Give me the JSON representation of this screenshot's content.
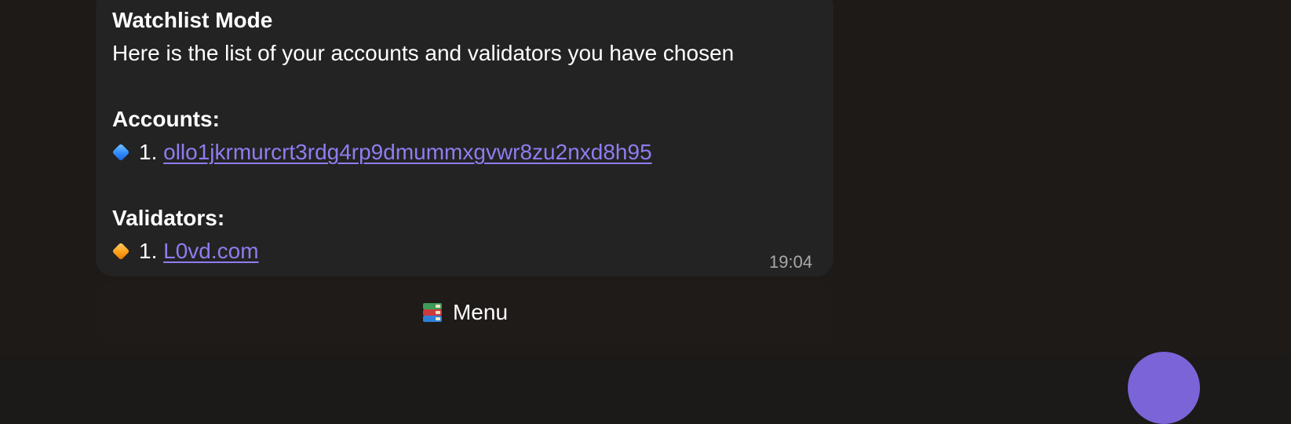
{
  "message": {
    "title": "Watchlist Mode",
    "intro": "Here is the list of your accounts and validators you have chosen",
    "accounts_heading": "Accounts:",
    "accounts": [
      {
        "index": "1.",
        "address": "ollo1jkrmurcrt3rdg4rp9dmummxgvwr8zu2nxd8h95",
        "icon": "blue-diamond-icon"
      }
    ],
    "validators_heading": "Validators:",
    "validators": [
      {
        "index": "1.",
        "name": "L0vd.com",
        "icon": "orange-diamond-icon"
      }
    ],
    "timestamp": "19:04"
  },
  "keyboard": {
    "button_label": "Menu",
    "button_icon": "books-icon"
  },
  "colors": {
    "background": "#1d1a18",
    "bubble": "#232323",
    "link": "#8f7df0",
    "timestamp": "#a9a9a9",
    "avatar": "#7b63d8"
  }
}
